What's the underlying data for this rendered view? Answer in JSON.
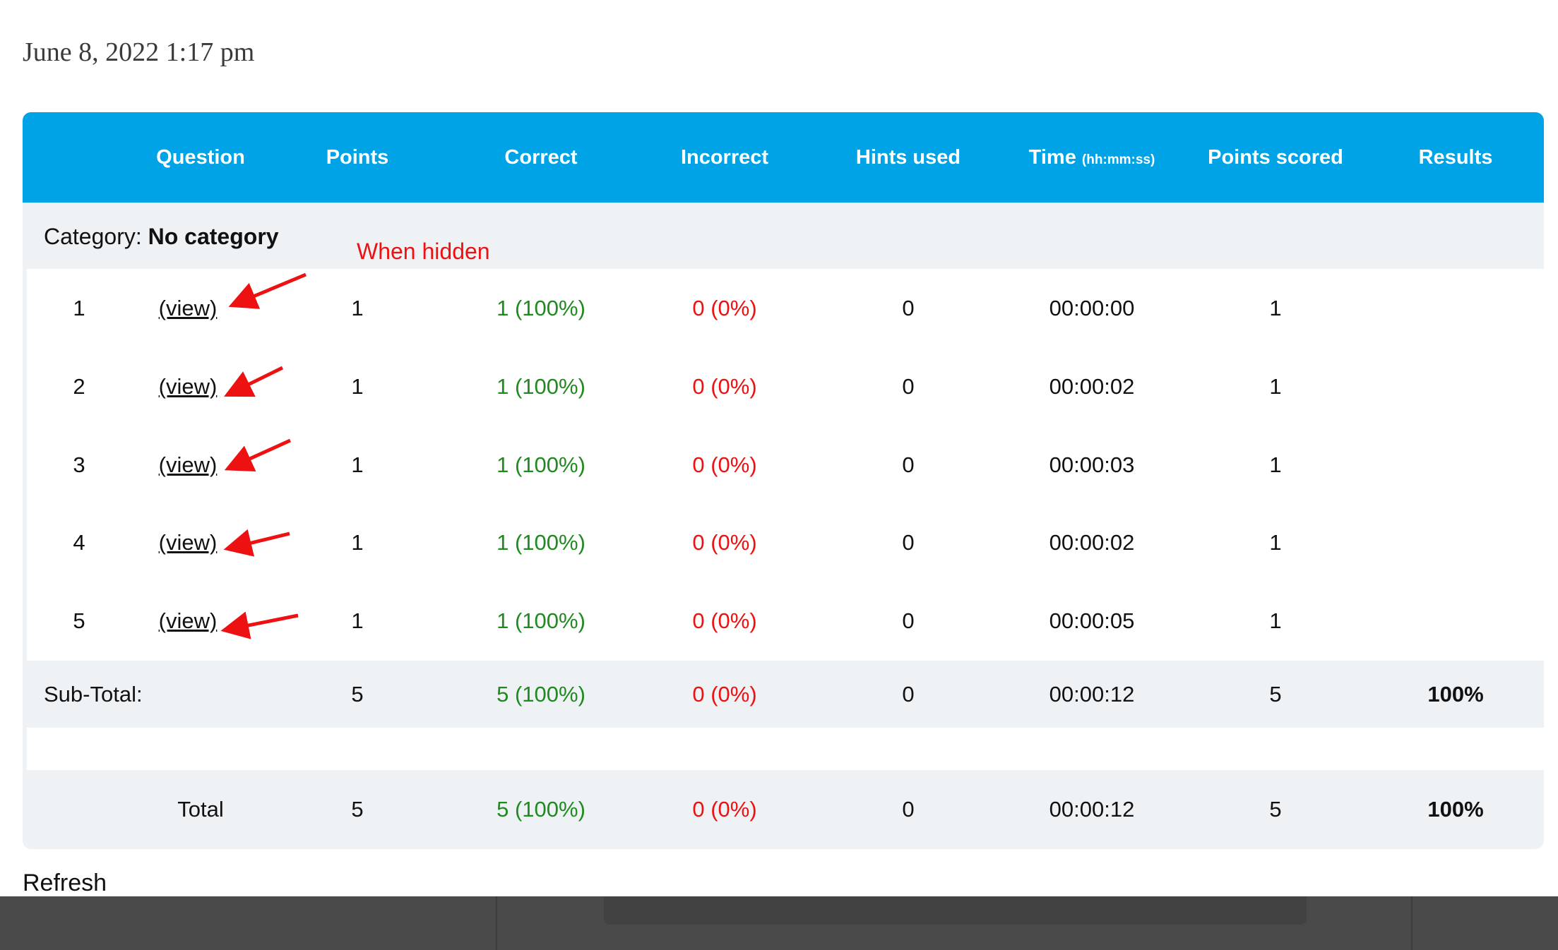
{
  "timestamp": "June 8, 2022 1:17 pm",
  "table": {
    "headers": {
      "question": "Question",
      "points": "Points",
      "correct": "Correct",
      "incorrect": "Incorrect",
      "hints_used": "Hints used",
      "time": "Time",
      "time_unit": "(hh:mm:ss)",
      "points_scored": "Points scored",
      "results": "Results"
    },
    "category": {
      "prefix": "Category:",
      "name": "No category"
    },
    "annotation": "When hidden",
    "rows": [
      {
        "num": "1",
        "link": "(view)",
        "points": "1",
        "correct": "1 (100%)",
        "incorrect": "0 (0%)",
        "hints": "0",
        "time": "00:00:00",
        "scored": "1"
      },
      {
        "num": "2",
        "link": "(view)",
        "points": "1",
        "correct": "1 (100%)",
        "incorrect": "0 (0%)",
        "hints": "0",
        "time": "00:00:02",
        "scored": "1"
      },
      {
        "num": "3",
        "link": "(view)",
        "points": "1",
        "correct": "1 (100%)",
        "incorrect": "0 (0%)",
        "hints": "0",
        "time": "00:00:03",
        "scored": "1"
      },
      {
        "num": "4",
        "link": "(view)",
        "points": "1",
        "correct": "1 (100%)",
        "incorrect": "0 (0%)",
        "hints": "0",
        "time": "00:00:02",
        "scored": "1"
      },
      {
        "num": "5",
        "link": "(view)",
        "points": "1",
        "correct": "1 (100%)",
        "incorrect": "0 (0%)",
        "hints": "0",
        "time": "00:00:05",
        "scored": "1"
      }
    ],
    "subtotal": {
      "label": "Sub-Total:",
      "points": "5",
      "correct": "5 (100%)",
      "incorrect": "0 (0%)",
      "hints": "0",
      "time": "00:00:12",
      "scored": "5",
      "result": "100%"
    },
    "total": {
      "label": "Total",
      "points": "5",
      "correct": "5 (100%)",
      "incorrect": "0 (0%)",
      "hints": "0",
      "time": "00:00:12",
      "scored": "5",
      "result": "100%"
    }
  },
  "refresh_label": "Refresh",
  "colors": {
    "header_bg": "#00a3e6",
    "correct": "#1f8a1f",
    "incorrect": "#ee1111",
    "arrow": "#ee1111"
  }
}
